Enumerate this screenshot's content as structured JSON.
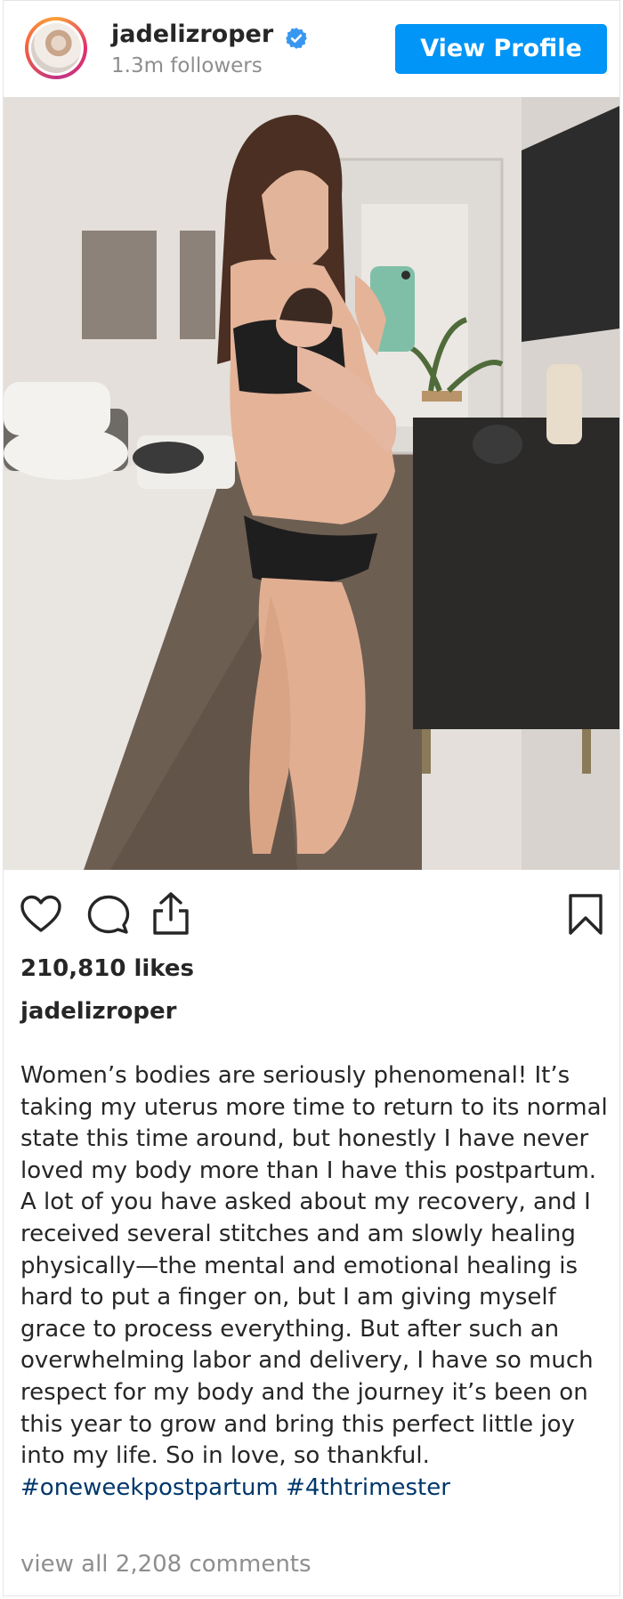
{
  "header": {
    "username": "jadelizroper",
    "followers": "1.3m followers",
    "view_profile_label": "View Profile",
    "verified_icon": "verified-badge-icon"
  },
  "post": {
    "photo_description_icon": "post-photo",
    "likes": "210,810 likes",
    "caption_username": "jadelizroper",
    "caption_text": "Women’s bodies are seriously phenomenal! It’s taking my uterus more time to return to its normal state this time around, but honestly I have never loved my body more than I have this postpartum. A lot of you have asked about my recovery, and I received several stitches and am slowly healing physically—the mental and emotional healing is hard to put a finger on, but I am giving myself grace to process everything. But after such an overwhelming labor and delivery, I have so much respect for my body and the journey it’s been on this year to grow and bring this perfect little joy into my life. So in love, so thankful.",
    "hashtags": [
      "#oneweekpostpartum",
      "#4thtrimester"
    ],
    "comments_link": "view all 2,208 comments"
  },
  "icons": {
    "like": "heart-icon",
    "comment": "comment-bubble-icon",
    "share": "share-icon",
    "save": "bookmark-icon"
  },
  "colors": {
    "accent": "#0095f6",
    "hashtag": "#00376b",
    "muted": "#8e8e8e",
    "text": "#262626"
  }
}
